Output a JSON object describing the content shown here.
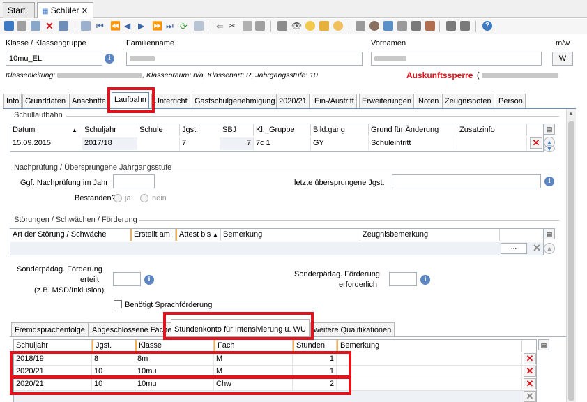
{
  "window_tabs": [
    {
      "label": "Start"
    },
    {
      "label": "Schüler",
      "close": "✕"
    }
  ],
  "header": {
    "klasse_label": "Klasse / Klassengruppe",
    "klasse_value": "10mu_EL",
    "familienname_label": "Familienname",
    "vornamen_label": "Vornamen",
    "mw_label": "m/w",
    "mw_value": "W",
    "klassenleitung_prefix": "Klassenleitung:",
    "klassenleitung_suffix": ", Klassenraum: n/a, Klassenart: R, Jahrgangsstufe: 10",
    "auskunftssperre": "Auskunftssperre",
    "auskunftssperre_paren": "("
  },
  "subtabs": [
    "Info",
    "Grunddaten",
    "Anschrifte",
    "Laufbahn",
    "Unterricht",
    "Gastschulgenehmigung",
    "2020/21",
    "Ein-/Austritt",
    "Erweiterungen",
    "Noten",
    "Zeugnisnoten",
    "Person"
  ],
  "schullaufbahn": {
    "title": "Schullaufbahn",
    "columns": [
      "Datum",
      "Schuljahr",
      "Schule",
      "Jgst.",
      "SBJ",
      "Kl._Gruppe",
      "Bild.gang",
      "Grund für Änderung",
      "Zusatzinfo"
    ],
    "rows": [
      [
        "15.09.2015",
        "2017/18",
        "",
        "7",
        "7",
        "7c 1",
        "GY",
        "Schuleintritt",
        ""
      ]
    ]
  },
  "nachpruefung": {
    "title": "Nachprüfung / Übersprungene Jahrgangsstufe",
    "ggf_label": "Ggf. Nachprüfung im Jahr",
    "bestanden_label": "Bestanden?",
    "ja": "ja",
    "nein": "nein",
    "letzte_label": "letzte übersprungene Jgst."
  },
  "stoerungen": {
    "title": "Störungen / Schwächen / Förderung",
    "columns": [
      "Art der Störung / Schwäche",
      "Erstellt am",
      "Attest bis",
      "Bemerkung",
      "Zeugnisbemerkung"
    ],
    "ellipsis": "...",
    "sonder_erteilt_l1": "Sonderpädag. Förderung",
    "sonder_erteilt_l2": "erteilt",
    "sonder_erteilt_l3": "(z.B. MSD/Inklusion)",
    "sonder_erf_l1": "Sonderpädag. Förderung",
    "sonder_erf_l2": "erforderlich",
    "sprach": "Benötigt Sprachförderung"
  },
  "bottom_tabs": [
    "Fremdsprachenfolge",
    "Abgeschlossene Fächer",
    "Stundenkonto für Intensivierung u. WU",
    "weitere Qualifikationen"
  ],
  "stundenkonto": {
    "columns": [
      "Schuljahr",
      "Jgst.",
      "Klasse",
      "Fach",
      "Stunden",
      "Bemerkung"
    ],
    "rows": [
      [
        "2018/19",
        "8",
        "8m",
        "M",
        "1",
        ""
      ],
      [
        "2020/21",
        "10",
        "10mu",
        "M",
        "1",
        ""
      ],
      [
        "2020/21",
        "10",
        "10mu",
        "Chw",
        "2",
        ""
      ]
    ]
  }
}
